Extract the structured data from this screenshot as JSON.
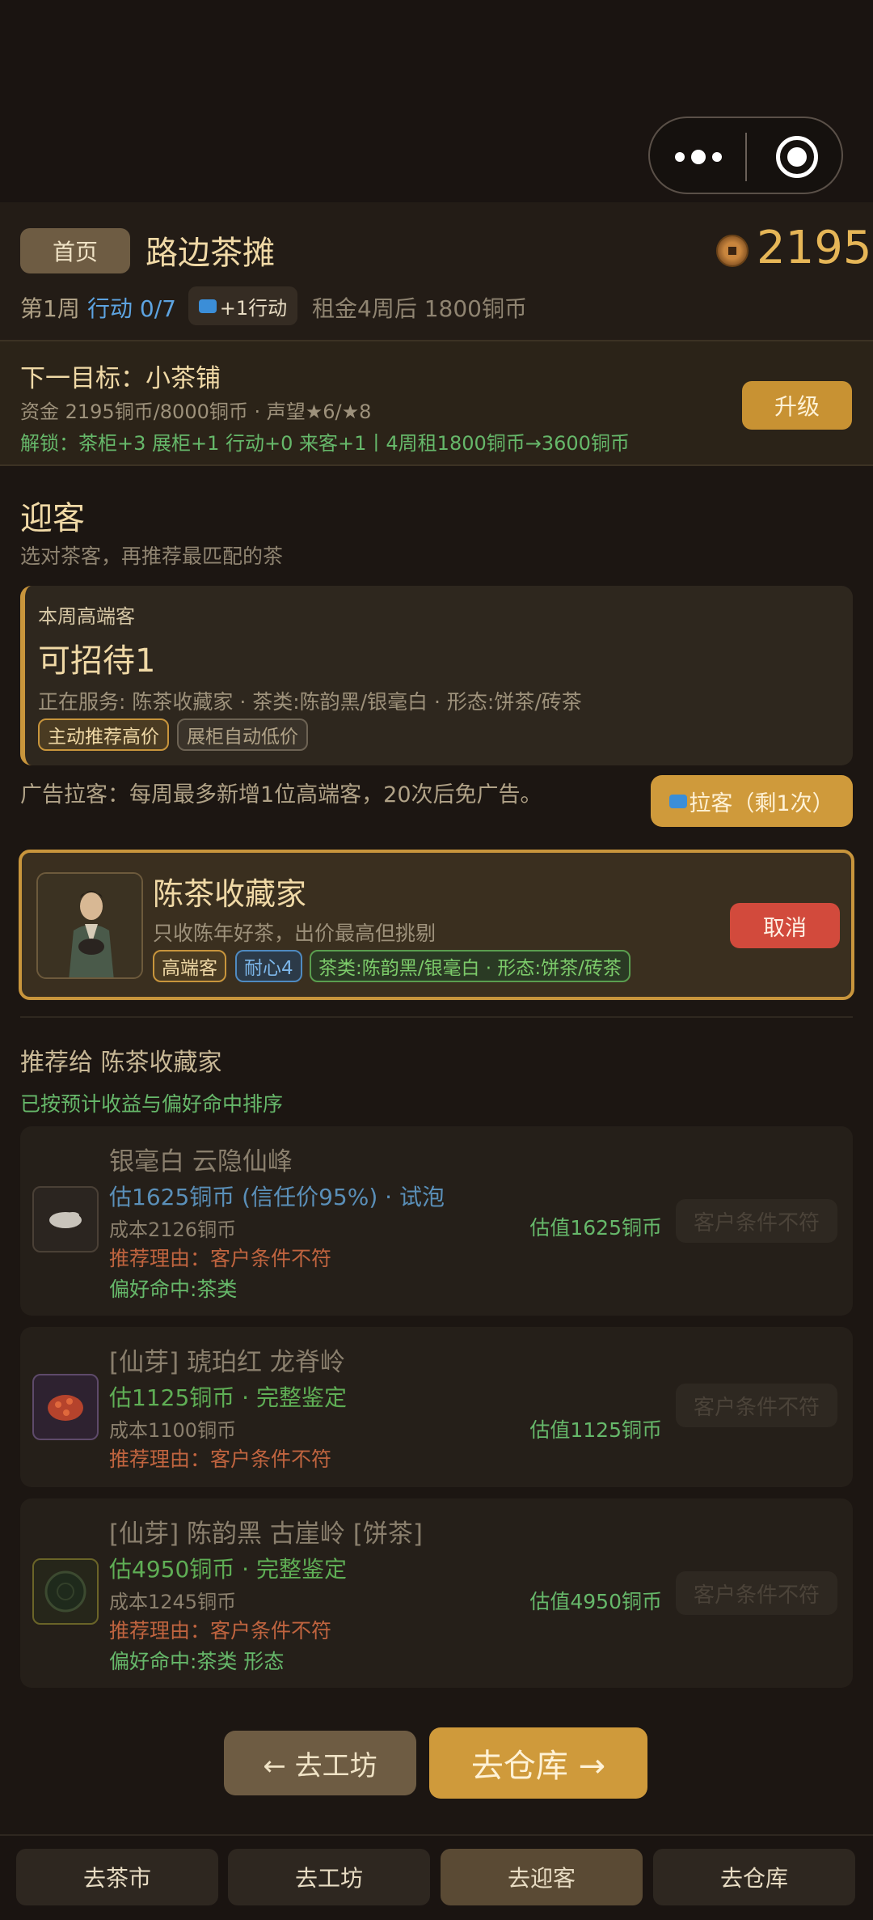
{
  "header": {
    "home_label": "首页",
    "shop_name": "路边茶摊",
    "coins": "2195",
    "week": "第1周",
    "action": "行动 0/7",
    "ad_action": "+1行动",
    "rent": "租金4周后 1800铜币"
  },
  "goal": {
    "title": "下一目标：小茶铺",
    "funds": "资金 2195铜币/8000铜币 · 声望★6/★8",
    "unlock": "解锁：茶柜+3 展柜+1 行动+0 来客+1丨4周租1800铜币→3600铜币",
    "upgrade_label": "升级"
  },
  "section": {
    "title": "迎客",
    "subtitle": "选对茶客，再推荐最匹配的茶"
  },
  "vip": {
    "label": "本周高端客",
    "count": "可招待1",
    "serving": "正在服务: 陈茶收藏家 · 茶类:陈韵黑/银毫白 · 形态:饼茶/砖茶",
    "pill_a": "主动推荐高价",
    "pill_b": "展柜自动低价",
    "ad_text": "广告拉客：每周最多新增1位高端客，20次后免广告。",
    "ad_button": "拉客（剩1次）"
  },
  "customer": {
    "name": "陈茶收藏家",
    "desc": "只收陈年好茶，出价最高但挑剔",
    "tag_level": "高端客",
    "tag_patience": "耐心4",
    "tag_type": "茶类:陈韵黑/银毫白 · 形态:饼茶/砖茶",
    "cancel_label": "取消"
  },
  "recommend": {
    "title": "推荐给 陈茶收藏家",
    "subtitle": "已按预计收益与偏好命中排序",
    "teas": [
      {
        "name": "银毫白 云隐仙峰",
        "est": "估1625铜币 (信任价95%) · 试泡",
        "cost": "成本2126铜币",
        "reason": "推荐理由：客户条件不符",
        "pref": "偏好命中:茶类",
        "value": "估值1625铜币",
        "button": "客户条件不符",
        "icon": "white-tea-icon"
      },
      {
        "name": "[仙芽] 琥珀红 龙脊岭",
        "est": "估1125铜币 · 完整鉴定",
        "cost": "成本1100铜币",
        "reason": "推荐理由：客户条件不符",
        "pref": "",
        "value": "估值1125铜币",
        "button": "客户条件不符",
        "icon": "red-tea-icon"
      },
      {
        "name": "[仙芽] 陈韵黑 古崖岭 [饼茶]",
        "est": "估4950铜币 · 完整鉴定",
        "cost": "成本1245铜币",
        "reason": "推荐理由：客户条件不符",
        "pref": "偏好命中:茶类 形态",
        "value": "估值4950铜币",
        "button": "客户条件不符",
        "icon": "dark-tea-cake-icon"
      }
    ]
  },
  "nav": {
    "workshop": "← 去工坊",
    "warehouse": "去仓库 →"
  },
  "tabs": [
    "去茶市",
    "去工坊",
    "去迎客",
    "去仓库"
  ],
  "colors": {
    "accent": "#cf9a3b",
    "danger": "#d24a3c",
    "green": "#66b86a",
    "blue": "#5da3e0"
  }
}
